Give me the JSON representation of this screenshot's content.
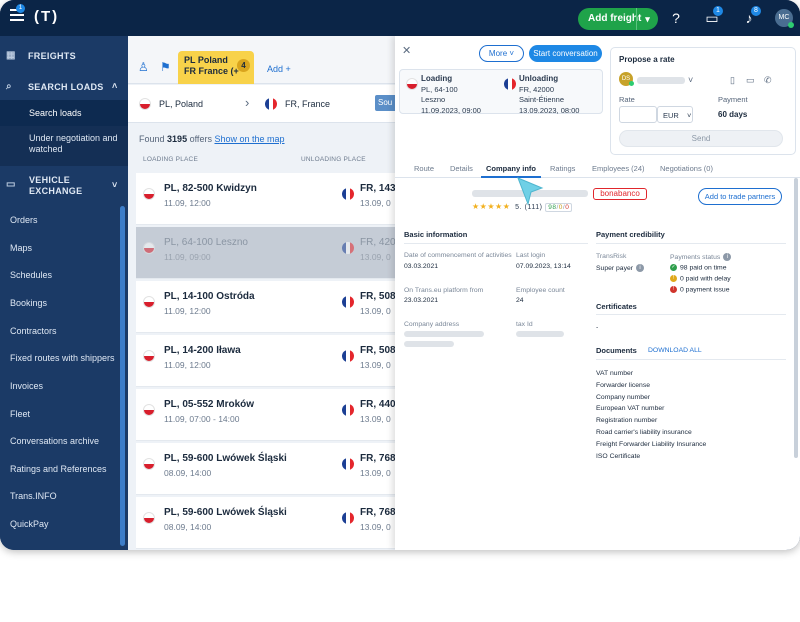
{
  "topbar": {
    "logo": "(T)",
    "menu_badge": "1",
    "add_freight": "Add freight",
    "messages_badge": "1",
    "notifications_badge": "8",
    "avatar_initials": "MC"
  },
  "sidebar": {
    "freights": "FREIGHTS",
    "search_loads": "SEARCH LOADS",
    "search_loads_sub": "Search loads",
    "under_negotiation": "Under negotiation and watched",
    "vehicle_exchange": "VEHICLE EXCHANGE",
    "items": [
      "Orders",
      "Maps",
      "Schedules",
      "Bookings",
      "Contractors",
      "Fixed routes with shippers",
      "Invoices",
      "Fleet",
      "Conversations archive",
      "Ratings and References",
      "Trans.INFO",
      "QuickPay"
    ]
  },
  "search": {
    "tab_line1": "PL Poland",
    "tab_line2": "FR France (+",
    "tab_count": "4",
    "add_tab": "Add +",
    "from_country": "PL, Poland",
    "to_country": "FR, France",
    "sort_label": "Sou",
    "found_prefix": "Found",
    "found_count": "3195",
    "found_suffix": "offers",
    "show_on_map": "Show on the map",
    "col_loading": "LOADING PLACE",
    "col_unloading": "UNLOADING PLACE"
  },
  "rows": [
    {
      "from": "PL, 82-500 Kwidzyn",
      "from_date": "11.09, 12:00",
      "to": "FR, 143",
      "to_date": "13.09, 0"
    },
    {
      "from": "PL, 64-100 Leszno",
      "from_date": "11.09, 09:00",
      "to": "FR, 420",
      "to_date": "13.09, 0"
    },
    {
      "from": "PL, 14-100 Ostróda",
      "from_date": "11.09, 12:00",
      "to": "FR, 508",
      "to_date": "13.09, 0"
    },
    {
      "from": "PL, 14-200 Iława",
      "from_date": "11.09, 12:00",
      "to": "FR, 508",
      "to_date": "13.09, 0"
    },
    {
      "from": "PL, 05-552 Mroków",
      "from_date": "11.09, 07:00 - 14:00",
      "to": "FR, 440",
      "to_date": "13.09, 0"
    },
    {
      "from": "PL, 59-600 Lwówek Śląski",
      "from_date": "08.09, 14:00",
      "to": "FR, 768",
      "to_date": "13.09, 0"
    },
    {
      "from": "PL, 59-600 Lwówek Śląski",
      "from_date": "08.09, 14:00",
      "to": "FR, 768",
      "to_date": "13.09, 0"
    }
  ],
  "detail": {
    "more": "More",
    "start_conversation": "Start conversation",
    "loading_label": "Loading",
    "loading_code": "PL, 64-100",
    "loading_city": "Leszno",
    "loading_time": "11.09.2023, 09:00",
    "unloading_label": "Unloading",
    "unloading_code": "FR, 42000",
    "unloading_city": "Saint-Étienne",
    "unloading_time": "13.09.2023, 08:00",
    "propose_rate": "Propose a rate",
    "rate_label": "Rate",
    "currency": "EUR",
    "payment_label": "Payment",
    "payment_value": "60 days",
    "send": "Send",
    "tabs": [
      "Route",
      "Details",
      "Company info",
      "Ratings",
      "Employees (24)",
      "Negotiations (0)"
    ],
    "brand": "bonabanco",
    "rating_score": "5.",
    "rating_count": "(111)",
    "rating_breakdown_g": "98",
    "rating_breakdown_y": "0",
    "rating_breakdown_r": "0",
    "add_trade": "Add to trade partners",
    "basic_info": "Basic information",
    "commencement_label": "Date of commencement of activities",
    "commencement_value": "03.03.2021",
    "last_login_label": "Last login",
    "last_login_value": "07.09.2023, 13:14",
    "platform_label": "On Trans.eu platform from",
    "platform_value": "23.03.2021",
    "employee_label": "Employee count",
    "employee_value": "24",
    "address_label": "Company address",
    "tax_label": "tax Id",
    "payment_cred": "Payment credibility",
    "transrisk_label": "TransRisk",
    "transrisk_value": "Super payer",
    "payments_status_label": "Payments status",
    "paid_on_time": "98 paid on time",
    "paid_delay": "0 paid with delay",
    "payment_issue": "0 payment issue",
    "certificates": "Certificates",
    "certificates_value": "-",
    "documents": "Documents",
    "download_all": "DOWNLOAD ALL",
    "docs": [
      "VAT number",
      "Forwarder license",
      "Company number",
      "European VAT number",
      "Registration number",
      "Road carrier's liability insurance",
      "Freight Forwarder Liability Insurance",
      "ISO Certificate"
    ]
  },
  "colors": {
    "sidebar": "#1b3a66",
    "topbar": "#0b2547",
    "accent": "#1e6fd0",
    "add_freight": "#1fa34a",
    "tab_yellow": "#f8d24a"
  }
}
